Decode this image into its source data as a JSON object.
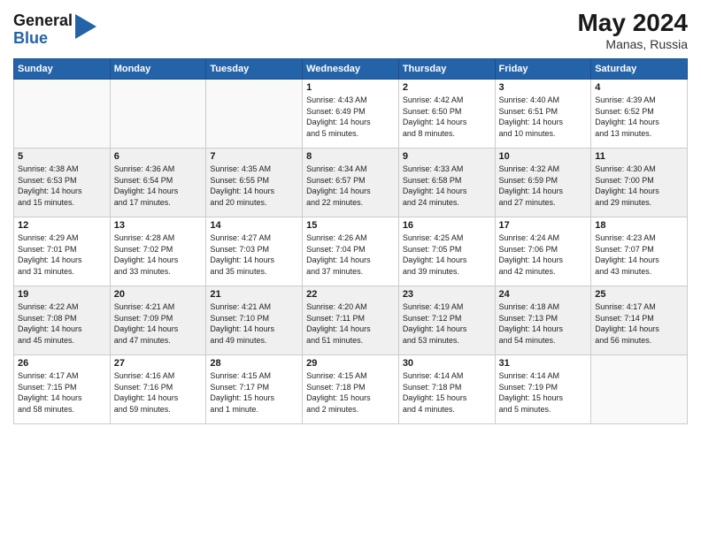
{
  "header": {
    "logo_general": "General",
    "logo_blue": "Blue",
    "month_year": "May 2024",
    "location": "Manas, Russia"
  },
  "days_of_week": [
    "Sunday",
    "Monday",
    "Tuesday",
    "Wednesday",
    "Thursday",
    "Friday",
    "Saturday"
  ],
  "weeks": [
    [
      {
        "day": "",
        "info": ""
      },
      {
        "day": "",
        "info": ""
      },
      {
        "day": "",
        "info": ""
      },
      {
        "day": "1",
        "info": "Sunrise: 4:43 AM\nSunset: 6:49 PM\nDaylight: 14 hours\nand 5 minutes."
      },
      {
        "day": "2",
        "info": "Sunrise: 4:42 AM\nSunset: 6:50 PM\nDaylight: 14 hours\nand 8 minutes."
      },
      {
        "day": "3",
        "info": "Sunrise: 4:40 AM\nSunset: 6:51 PM\nDaylight: 14 hours\nand 10 minutes."
      },
      {
        "day": "4",
        "info": "Sunrise: 4:39 AM\nSunset: 6:52 PM\nDaylight: 14 hours\nand 13 minutes."
      }
    ],
    [
      {
        "day": "5",
        "info": "Sunrise: 4:38 AM\nSunset: 6:53 PM\nDaylight: 14 hours\nand 15 minutes."
      },
      {
        "day": "6",
        "info": "Sunrise: 4:36 AM\nSunset: 6:54 PM\nDaylight: 14 hours\nand 17 minutes."
      },
      {
        "day": "7",
        "info": "Sunrise: 4:35 AM\nSunset: 6:55 PM\nDaylight: 14 hours\nand 20 minutes."
      },
      {
        "day": "8",
        "info": "Sunrise: 4:34 AM\nSunset: 6:57 PM\nDaylight: 14 hours\nand 22 minutes."
      },
      {
        "day": "9",
        "info": "Sunrise: 4:33 AM\nSunset: 6:58 PM\nDaylight: 14 hours\nand 24 minutes."
      },
      {
        "day": "10",
        "info": "Sunrise: 4:32 AM\nSunset: 6:59 PM\nDaylight: 14 hours\nand 27 minutes."
      },
      {
        "day": "11",
        "info": "Sunrise: 4:30 AM\nSunset: 7:00 PM\nDaylight: 14 hours\nand 29 minutes."
      }
    ],
    [
      {
        "day": "12",
        "info": "Sunrise: 4:29 AM\nSunset: 7:01 PM\nDaylight: 14 hours\nand 31 minutes."
      },
      {
        "day": "13",
        "info": "Sunrise: 4:28 AM\nSunset: 7:02 PM\nDaylight: 14 hours\nand 33 minutes."
      },
      {
        "day": "14",
        "info": "Sunrise: 4:27 AM\nSunset: 7:03 PM\nDaylight: 14 hours\nand 35 minutes."
      },
      {
        "day": "15",
        "info": "Sunrise: 4:26 AM\nSunset: 7:04 PM\nDaylight: 14 hours\nand 37 minutes."
      },
      {
        "day": "16",
        "info": "Sunrise: 4:25 AM\nSunset: 7:05 PM\nDaylight: 14 hours\nand 39 minutes."
      },
      {
        "day": "17",
        "info": "Sunrise: 4:24 AM\nSunset: 7:06 PM\nDaylight: 14 hours\nand 42 minutes."
      },
      {
        "day": "18",
        "info": "Sunrise: 4:23 AM\nSunset: 7:07 PM\nDaylight: 14 hours\nand 43 minutes."
      }
    ],
    [
      {
        "day": "19",
        "info": "Sunrise: 4:22 AM\nSunset: 7:08 PM\nDaylight: 14 hours\nand 45 minutes."
      },
      {
        "day": "20",
        "info": "Sunrise: 4:21 AM\nSunset: 7:09 PM\nDaylight: 14 hours\nand 47 minutes."
      },
      {
        "day": "21",
        "info": "Sunrise: 4:21 AM\nSunset: 7:10 PM\nDaylight: 14 hours\nand 49 minutes."
      },
      {
        "day": "22",
        "info": "Sunrise: 4:20 AM\nSunset: 7:11 PM\nDaylight: 14 hours\nand 51 minutes."
      },
      {
        "day": "23",
        "info": "Sunrise: 4:19 AM\nSunset: 7:12 PM\nDaylight: 14 hours\nand 53 minutes."
      },
      {
        "day": "24",
        "info": "Sunrise: 4:18 AM\nSunset: 7:13 PM\nDaylight: 14 hours\nand 54 minutes."
      },
      {
        "day": "25",
        "info": "Sunrise: 4:17 AM\nSunset: 7:14 PM\nDaylight: 14 hours\nand 56 minutes."
      }
    ],
    [
      {
        "day": "26",
        "info": "Sunrise: 4:17 AM\nSunset: 7:15 PM\nDaylight: 14 hours\nand 58 minutes."
      },
      {
        "day": "27",
        "info": "Sunrise: 4:16 AM\nSunset: 7:16 PM\nDaylight: 14 hours\nand 59 minutes."
      },
      {
        "day": "28",
        "info": "Sunrise: 4:15 AM\nSunset: 7:17 PM\nDaylight: 15 hours\nand 1 minute."
      },
      {
        "day": "29",
        "info": "Sunrise: 4:15 AM\nSunset: 7:18 PM\nDaylight: 15 hours\nand 2 minutes."
      },
      {
        "day": "30",
        "info": "Sunrise: 4:14 AM\nSunset: 7:18 PM\nDaylight: 15 hours\nand 4 minutes."
      },
      {
        "day": "31",
        "info": "Sunrise: 4:14 AM\nSunset: 7:19 PM\nDaylight: 15 hours\nand 5 minutes."
      },
      {
        "day": "",
        "info": ""
      }
    ]
  ]
}
